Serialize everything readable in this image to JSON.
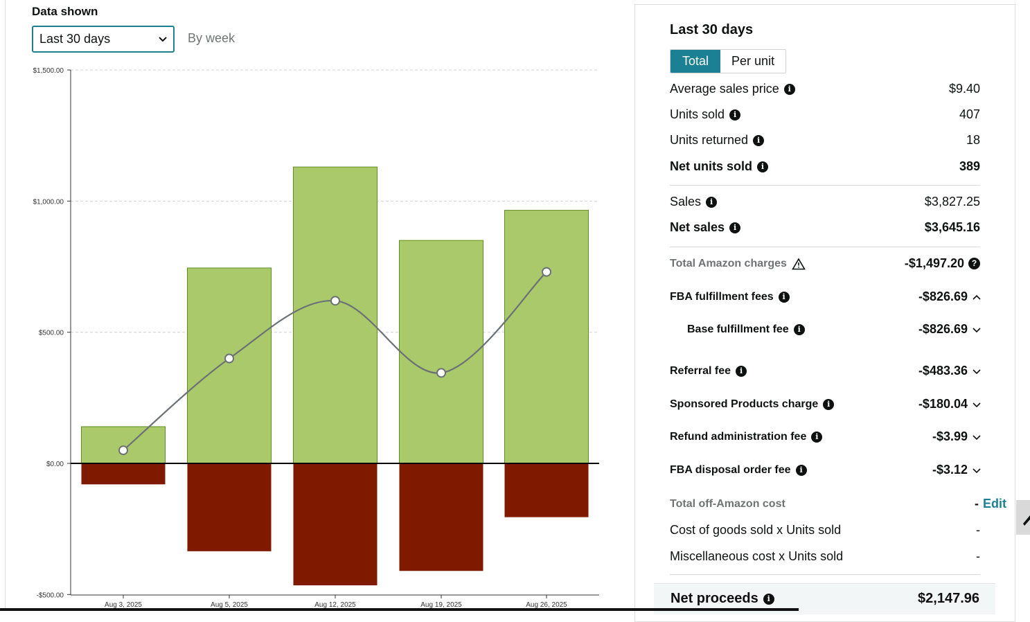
{
  "filters": {
    "label": "Data shown",
    "period_value": "Last 30 days",
    "granularity": "By week"
  },
  "chart_data": {
    "type": "bar",
    "categories": [
      "Aug 3, 2025",
      "Aug 5, 2025",
      "Aug 12, 2025",
      "Aug 19, 2025",
      "Aug 26, 2025"
    ],
    "y_ticks": [
      "$1,500.00",
      "$1,000.00",
      "$500.00",
      "$0.00",
      "-$500.00"
    ],
    "ylim": [
      -500,
      1500
    ],
    "grid": true,
    "series": [
      {
        "values": [
          140,
          745,
          1130,
          850,
          965
        ],
        "color": "#a9c96b"
      },
      {
        "values": [
          -80,
          -335,
          -465,
          -410,
          -205
        ],
        "color": "#7f1a00"
      },
      {
        "values": [
          50,
          400,
          620,
          345,
          730
        ],
        "color": "#6b7174"
      }
    ]
  },
  "panel": {
    "title": "Last 30 days",
    "toggle": {
      "total": "Total",
      "per_unit": "Per unit"
    },
    "avg_price": {
      "label": "Average sales price",
      "value": "$9.40"
    },
    "units_sold": {
      "label": "Units sold",
      "value": "407"
    },
    "units_returned": {
      "label": "Units returned",
      "value": "18"
    },
    "net_units": {
      "label": "Net units sold",
      "value": "389"
    },
    "sales": {
      "label": "Sales",
      "value": "$3,827.25"
    },
    "net_sales": {
      "label": "Net sales",
      "value": "$3,645.16"
    },
    "amazon_charges": {
      "label": "Total Amazon charges",
      "value": "-$1,497.20"
    },
    "fba_fees": {
      "label": "FBA fulfillment fees",
      "value": "-$826.69"
    },
    "base_fee": {
      "label": "Base fulfillment fee",
      "value": "-$826.69"
    },
    "referral": {
      "label": "Referral fee",
      "value": "-$483.36"
    },
    "sponsored": {
      "label": "Sponsored Products charge",
      "value": "-$180.04"
    },
    "refund_admin": {
      "label": "Refund administration fee",
      "value": "-$3.99"
    },
    "disposal": {
      "label": "FBA disposal order fee",
      "value": "-$3.12"
    },
    "off_amazon": {
      "label": "Total off-Amazon cost",
      "dash": "-",
      "edit": "Edit"
    },
    "cogs": {
      "label": "Cost of goods sold x Units sold",
      "value": "-"
    },
    "misc": {
      "label": "Miscellaneous cost x Units sold",
      "value": "-"
    },
    "net_proceeds": {
      "label": "Net proceeds",
      "value": "$2,147.96"
    }
  }
}
